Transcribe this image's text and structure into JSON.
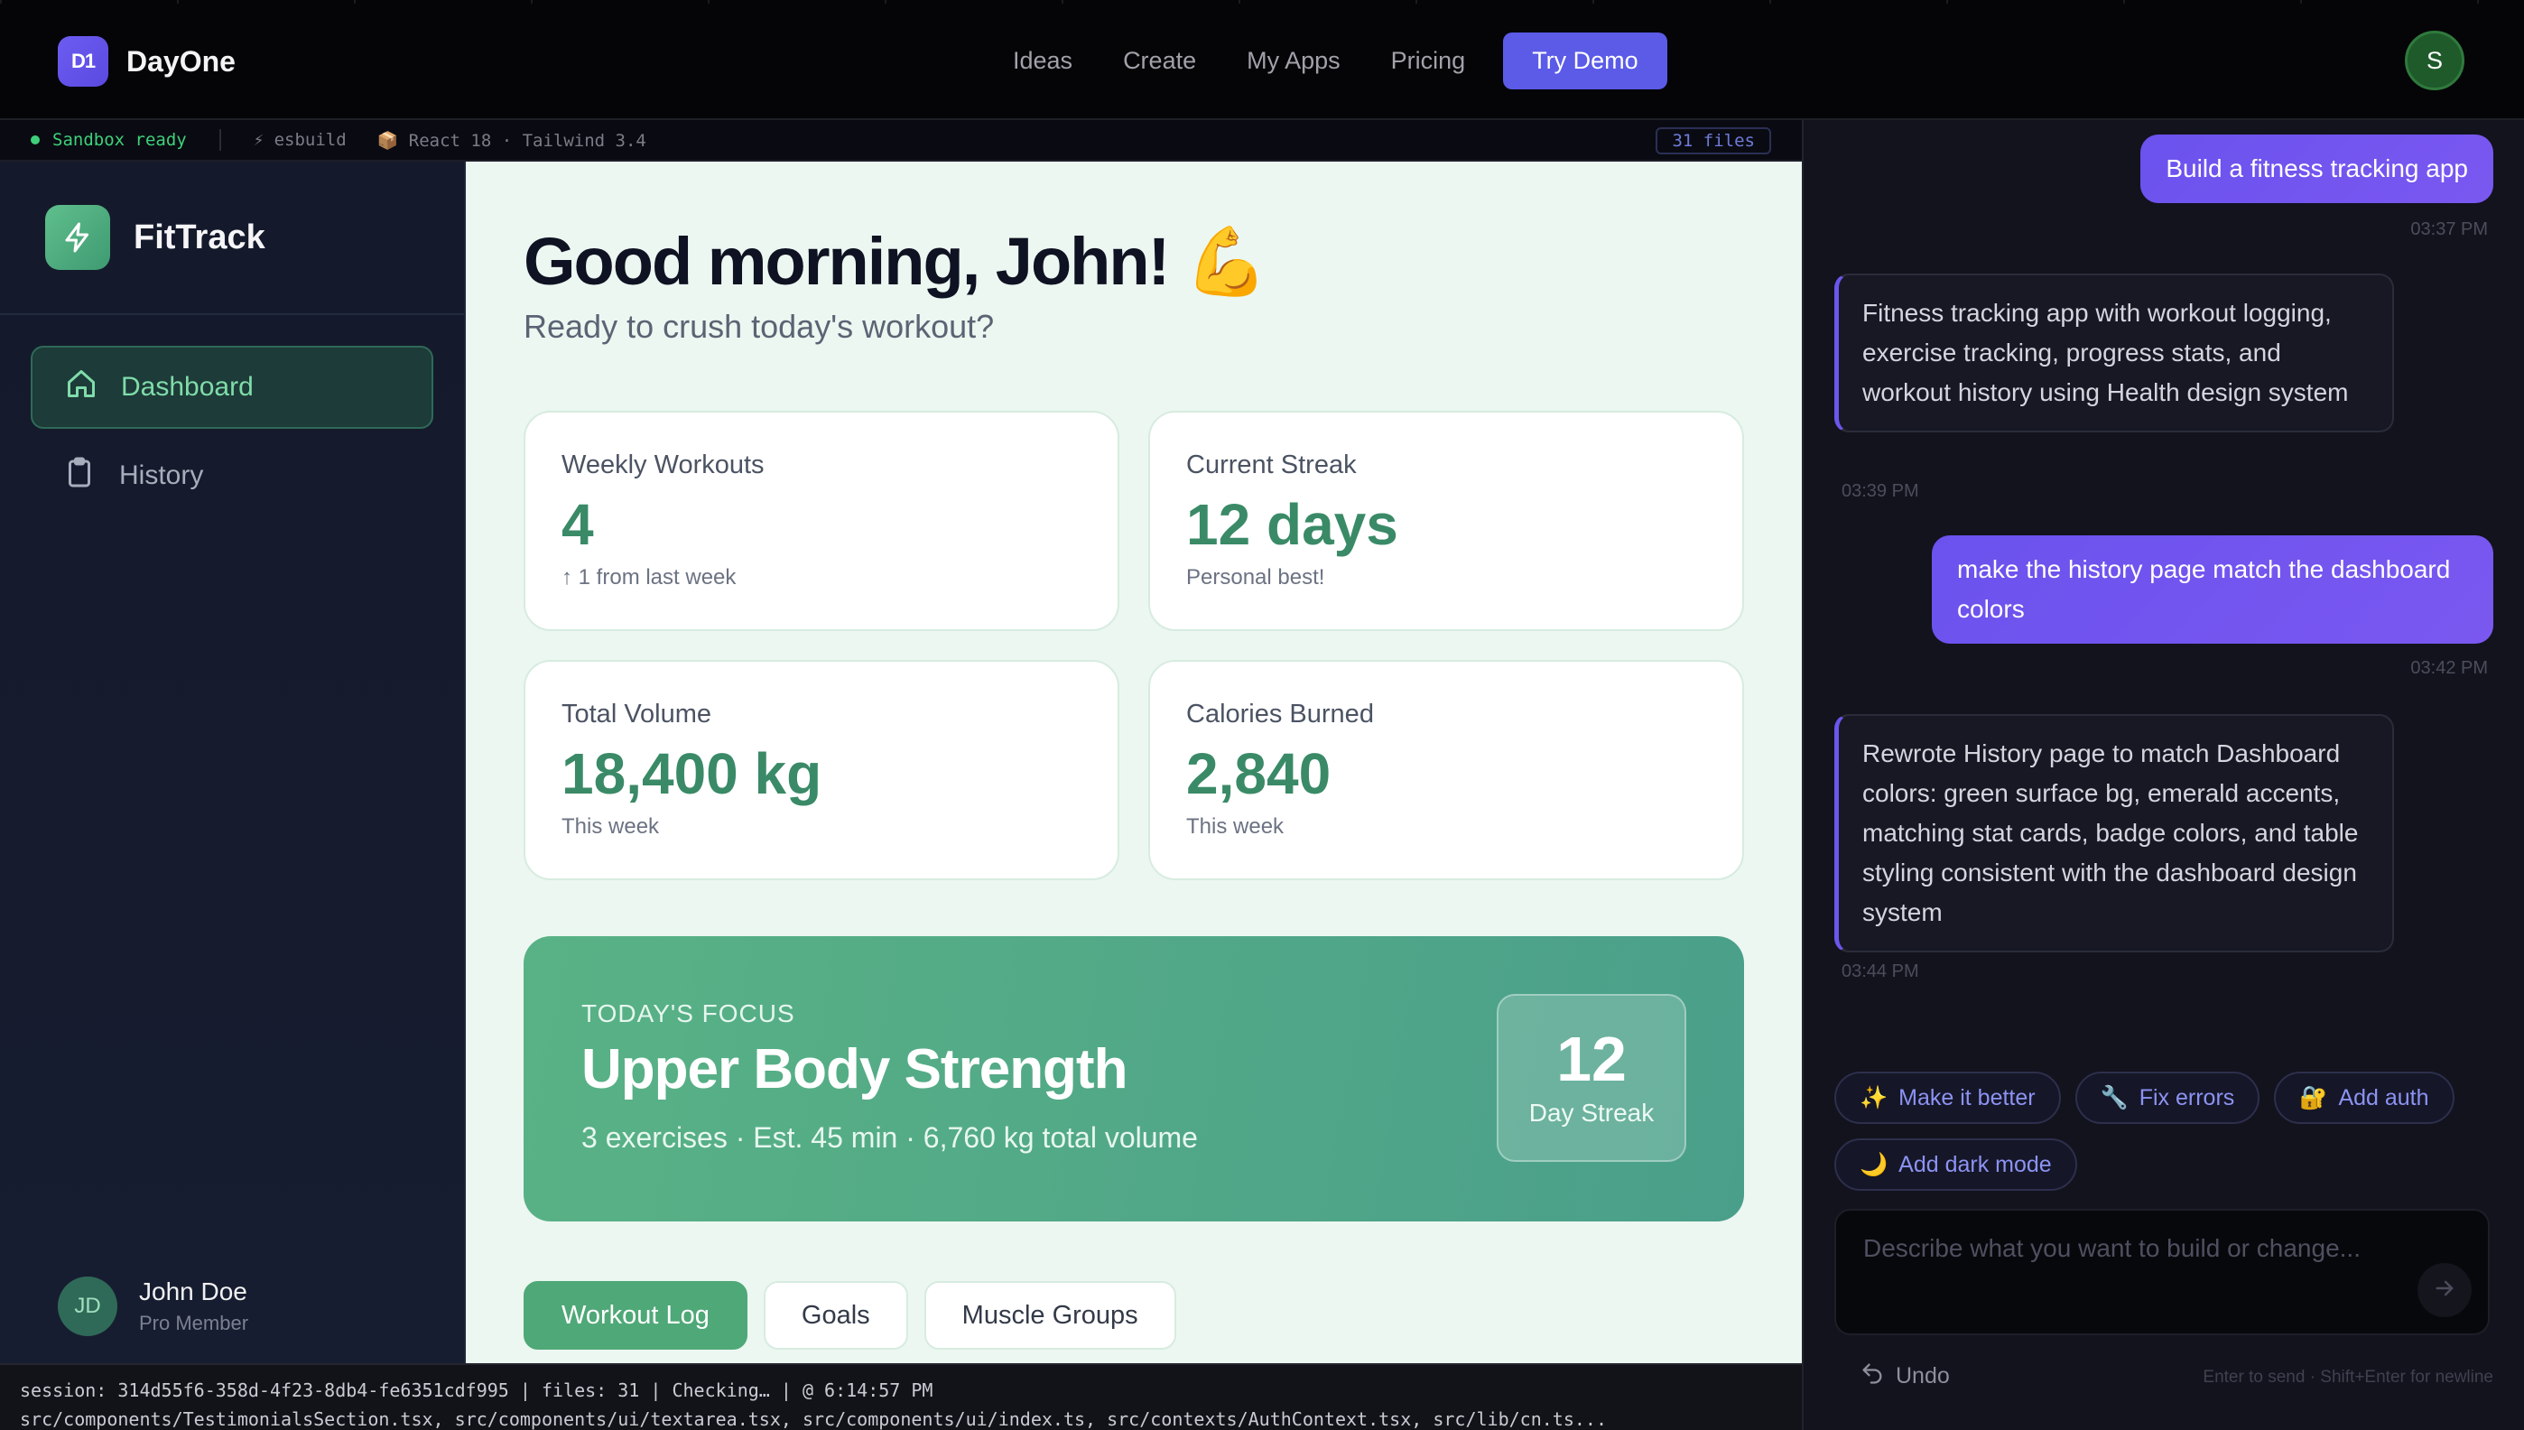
{
  "nav": {
    "brand_logo_text": "D1",
    "brand_name": "DayOne",
    "links": [
      "Ideas",
      "Create",
      "My Apps",
      "Pricing"
    ],
    "cta": "Try Demo",
    "avatar_initial": "S"
  },
  "status": {
    "ready": "Sandbox ready",
    "bundler": "⚡ esbuild",
    "stack": "📦 React 18 · Tailwind 3.4",
    "files": "31 files"
  },
  "app": {
    "title": "FitTrack",
    "nav": [
      {
        "label": "Dashboard",
        "icon": "home-icon",
        "active": true
      },
      {
        "label": "History",
        "icon": "clipboard-icon",
        "active": false
      }
    ],
    "user": {
      "initials": "JD",
      "name": "John Doe",
      "role": "Pro Member"
    },
    "greeting": "Good morning, John! 💪",
    "subgreeting": "Ready to crush today's workout?",
    "stats": [
      {
        "label": "Weekly Workouts",
        "value": "4",
        "sub": "↑ 1 from last week"
      },
      {
        "label": "Current Streak",
        "value": "12 days",
        "sub": "Personal best!"
      },
      {
        "label": "Total Volume",
        "value": "18,400 kg",
        "sub": "This week"
      },
      {
        "label": "Calories Burned",
        "value": "2,840",
        "sub": "This week"
      }
    ],
    "focus": {
      "eyebrow": "TODAY'S FOCUS",
      "title": "Upper Body Strength",
      "meta": "3 exercises · Est. 45 min · 6,760 kg total volume",
      "streak_number": "12",
      "streak_label": "Day Streak"
    },
    "tabs": [
      "Workout Log",
      "Goals",
      "Muscle Groups"
    ]
  },
  "log": {
    "line1": "session: 314d55f6-358d-4f23-8db4-fe6351cdf995 | files: 31 | Checking… | @ 6:14:57 PM",
    "line2": "src/components/TestimonialsSection.tsx, src/components/ui/textarea.tsx, src/components/ui/index.ts, src/contexts/AuthContext.tsx, src/lib/cn.ts..."
  },
  "chat": {
    "messages": [
      {
        "role": "user",
        "text": "Build a fitness tracking app",
        "time": "03:37 PM"
      },
      {
        "role": "assistant",
        "text": "Fitness tracking app with workout logging, exercise tracking, progress stats, and workout history using Health design system",
        "time": "03:39 PM"
      },
      {
        "role": "user",
        "text": "make the history page match the dashboard colors",
        "time": "03:42 PM"
      },
      {
        "role": "assistant",
        "text": "Rewrote History page to match Dashboard colors: green surface bg, emerald accents, matching stat cards, badge colors, and table styling consistent with the dashboard design system",
        "time": "03:44 PM"
      }
    ],
    "chips": [
      {
        "icon": "✨",
        "label": "Make it better"
      },
      {
        "icon": "🔧",
        "label": "Fix errors"
      },
      {
        "icon": "🔐",
        "label": "Add auth"
      },
      {
        "icon": "🌙",
        "label": "Add dark mode"
      }
    ],
    "placeholder": "Describe what you want to build or change...",
    "undo": "Undo",
    "hint": "Enter to send · Shift+Enter for newline"
  },
  "colors": {
    "accent": "#5b5be8",
    "app_green": "#3a8a67",
    "chat_bubble": "#6b52ee"
  }
}
